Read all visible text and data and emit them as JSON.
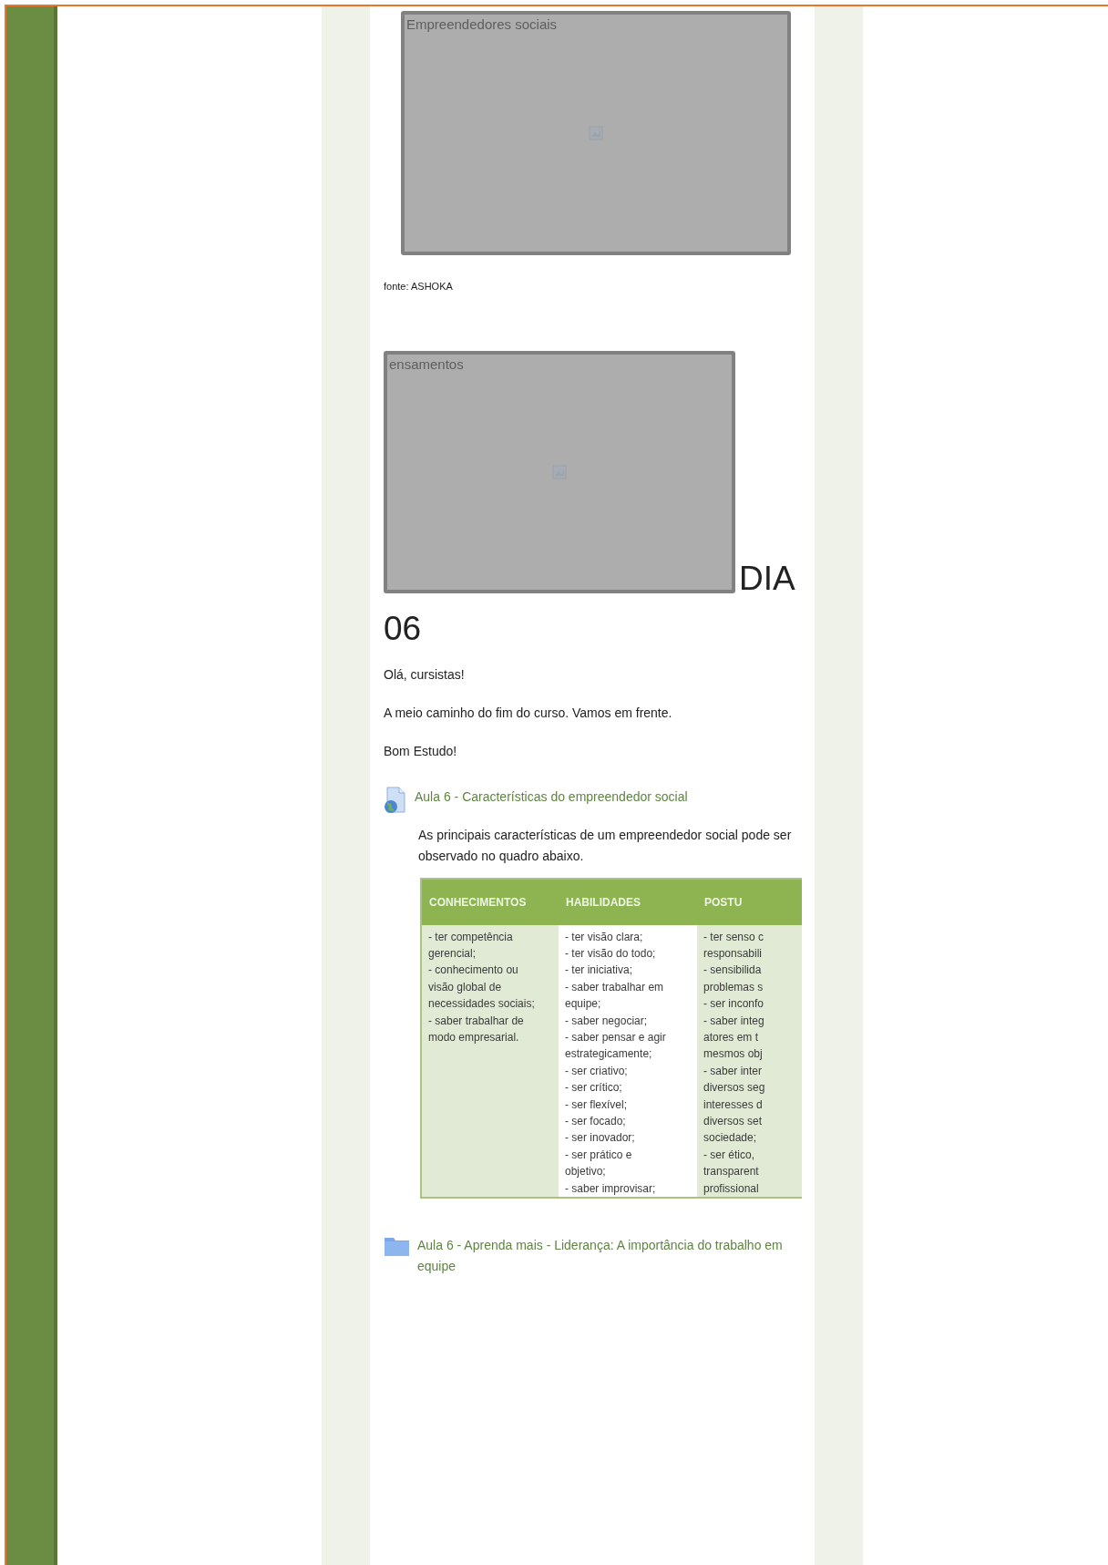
{
  "figure_1": {
    "alt_text": "Empreendedores sociais"
  },
  "caption": "fonte: ASHOKA",
  "figure_2": {
    "alt_text": "ensamentos"
  },
  "heading_lines": [
    "DIA",
    "06"
  ],
  "paragraphs": [
    "Olá, cursistas!",
    "A meio caminho do fim do curso. Vamos em frente.",
    "Bom Estudo!"
  ],
  "resources": [
    {
      "kind": "page",
      "title": "Aula 6 - Características do empreendedor social",
      "description": "As principais características de um empreendedor social pode ser observado no quadro abaixo.",
      "table": {
        "columns": [
          "CONHECIMENTOS",
          "HABILIDADES",
          "POSTU"
        ],
        "cells": [
          [
            "- ter competência",
            "gerencial;",
            "- conhecimento ou",
            "visão global de",
            "necessidades sociais;",
            "- saber trabalhar de",
            "modo empresarial."
          ],
          [
            "- ter visão clara;",
            "- ter visão do todo;",
            "- ter iniciativa;",
            "- saber trabalhar em",
            "equipe;",
            "- saber negociar;",
            "- saber pensar e agir",
            "estrategicamente;",
            "- ser criativo;",
            "- ser crítico;",
            "- ser flexível;",
            "- ser focado;",
            "- ser inovador;",
            "- ser prático e",
            "objetivo;",
            "- saber improvisar;"
          ],
          [
            "- ter senso c",
            "responsabili",
            "- sensibilida",
            "problemas s",
            "- ser inconfo",
            "- saber integ",
            "atores em t",
            "mesmos obj",
            "- saber inter",
            "diversos seg",
            "interesses d",
            "diversos set",
            "sociedade;",
            "- ser ético,",
            "transparent",
            "profissional"
          ]
        ]
      }
    },
    {
      "kind": "folder",
      "title": "Aula 6 - Aprenda mais - Liderança: A importância do trabalho em equipe"
    }
  ]
}
